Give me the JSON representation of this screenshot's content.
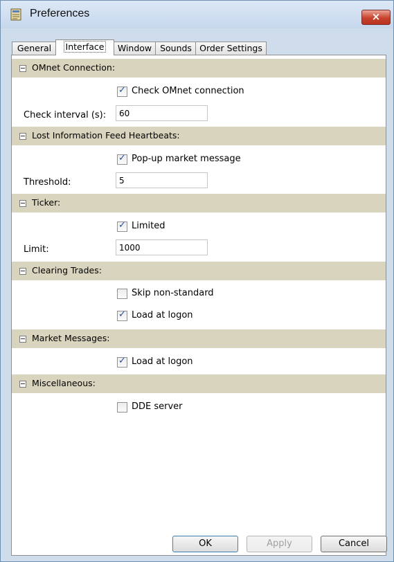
{
  "window": {
    "title": "Preferences",
    "close_glyph": "×",
    "icon": "preferences-app-icon"
  },
  "tabs": [
    {
      "label": "General",
      "active": false
    },
    {
      "label": "Interface",
      "active": true
    },
    {
      "label": "Window",
      "active": false
    },
    {
      "label": "Sounds",
      "active": false
    },
    {
      "label": "Order Settings",
      "active": false
    }
  ],
  "sections": {
    "omnet": {
      "title": "OMnet Connection:",
      "check_label": "Check OMnet connection",
      "check_checked": true,
      "interval_label": "Check interval (s):",
      "interval_value": "60"
    },
    "heartbeats": {
      "title": "Lost Information Feed Heartbeats:",
      "popup_label": "Pop-up market message",
      "popup_checked": true,
      "threshold_label": "Threshold:",
      "threshold_value": "5"
    },
    "ticker": {
      "title": "Ticker:",
      "limited_label": "Limited",
      "limited_checked": true,
      "limit_label": "Limit:",
      "limit_value": "1000"
    },
    "clearing": {
      "title": "Clearing Trades:",
      "skip_label": "Skip non-standard",
      "skip_checked": false,
      "load_label": "Load at logon",
      "load_checked": true
    },
    "market_messages": {
      "title": "Market Messages:",
      "load_label": "Load at logon",
      "load_checked": true
    },
    "misc": {
      "title": "Miscellaneous:",
      "dde_label": "DDE server",
      "dde_checked": false
    }
  },
  "buttons": {
    "ok": "OK",
    "apply": "Apply",
    "apply_enabled": false,
    "cancel": "Cancel"
  },
  "colors": {
    "section_header_bg": "#d9d4bd",
    "window_frame": "#cfdcec",
    "close_button": "#c8432e",
    "checkmark": "#2b4da0"
  }
}
